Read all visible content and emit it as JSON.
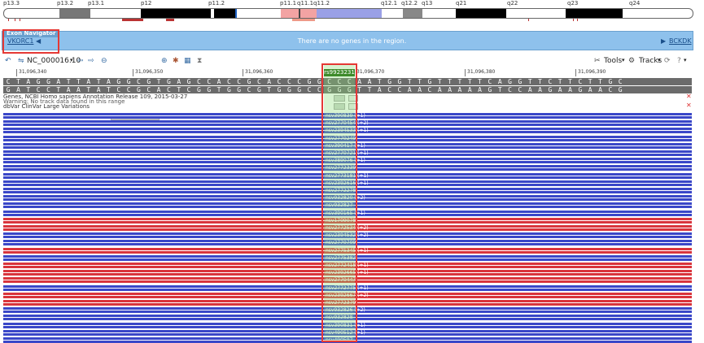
{
  "ideogram": {
    "bands": [
      "p13.3",
      "p13.2",
      "p13.1",
      "p12",
      "p11.2",
      "p11.1",
      "q11.1",
      "q11.2",
      "q12.1",
      "q12.2",
      "q13",
      "q21",
      "q22",
      "q23",
      "q24"
    ]
  },
  "exon_navigator": {
    "title": "Exon Navigator",
    "gene_link": "VKORC1",
    "prev_icon": "chevron-left-icon",
    "message": "There are no genes in the region.",
    "next_link": "BCKDK"
  },
  "toolbar": {
    "sequence_id": "NC_000016.10",
    "tools_label": "Tools",
    "tracks_label": "Tracks",
    "help_label": "?"
  },
  "ruler": {
    "labels": [
      "31,096,340",
      "31,096,350",
      "31,096,360",
      "31,096,370",
      "31,096,380",
      "31,096,390"
    ]
  },
  "snp": {
    "label": "rs9923231"
  },
  "sequence": {
    "forward": "CTAGGATTATAGGCGTGAGCCACCGCACCCGGCCCAATGGTTGTTTTTCAGGTTCTTCTTGC",
    "reverse": "GATCCTAATATCCGCACTCGGTGGCGTGGGCCGGGTTACCAACAAAAAGTCCAAGAAGAACG"
  },
  "tracks": {
    "genes_title": "Genes, NCBI Homo sapiens Annotation Release 109, 2015-03-27",
    "genes_warning": "Warning: No track data found in this range",
    "clinvar_title": "dbVar ClinVar Large Variations"
  },
  "variations": [
    {
      "label": "nsv390839 (+1)",
      "color": "blue"
    },
    {
      "label": "nsv2770454 (+2)",
      "color": "blue"
    },
    {
      "label": "nsv2394533 (+1)",
      "color": "blue"
    },
    {
      "label": "nsv2770249",
      "color": "blue"
    },
    {
      "label": "nsv390417 (+1)",
      "color": "blue"
    },
    {
      "label": "nsv2770721 (+1)",
      "color": "blue"
    },
    {
      "label": "nsv389076 (+1)",
      "color": "blue"
    },
    {
      "label": "nsv2772339",
      "color": "blue"
    },
    {
      "label": "nsv2773181 (+1)",
      "color": "blue"
    },
    {
      "label": "nsv2392616 (+1)",
      "color": "blue"
    },
    {
      "label": "nsv2772278",
      "color": "blue"
    },
    {
      "label": "nsv932820 (+2)",
      "color": "blue"
    },
    {
      "label": "nsv932827",
      "color": "blue"
    },
    {
      "label": "nsv390165 (+1)",
      "color": "blue"
    },
    {
      "label": "nsv1709078",
      "color": "red"
    },
    {
      "label": "nsv2772534 (+2)",
      "color": "red"
    },
    {
      "label": "nsv2394532 (+2)",
      "color": "blue"
    },
    {
      "label": "nsv2770709",
      "color": "blue"
    },
    {
      "label": "nsv2775345 (+1)",
      "color": "red"
    },
    {
      "label": "nsv2775382",
      "color": "blue"
    },
    {
      "label": "nsv2772418 (+1)",
      "color": "red"
    },
    {
      "label": "nsv2392665 (+1)",
      "color": "red"
    },
    {
      "label": "nsv2770447",
      "color": "red"
    },
    {
      "label": "nsv2772775 (+1)",
      "color": "blue"
    },
    {
      "label": "nsv2392667 (+2)",
      "color": "red"
    },
    {
      "label": "nsv2772379",
      "color": "red"
    },
    {
      "label": "nsv932826 (+2)",
      "color": "blue"
    },
    {
      "label": "nsv932828",
      "color": "blue"
    },
    {
      "label": "nsv390831 (+1)",
      "color": "blue"
    },
    {
      "label": "nsv490512 (+1)",
      "color": "blue"
    },
    {
      "label": "nsv490597",
      "color": "blue"
    }
  ],
  "colors": {
    "blue": "#3a47c8",
    "red": "#d9343c",
    "highlight": "#3d8b2a"
  }
}
